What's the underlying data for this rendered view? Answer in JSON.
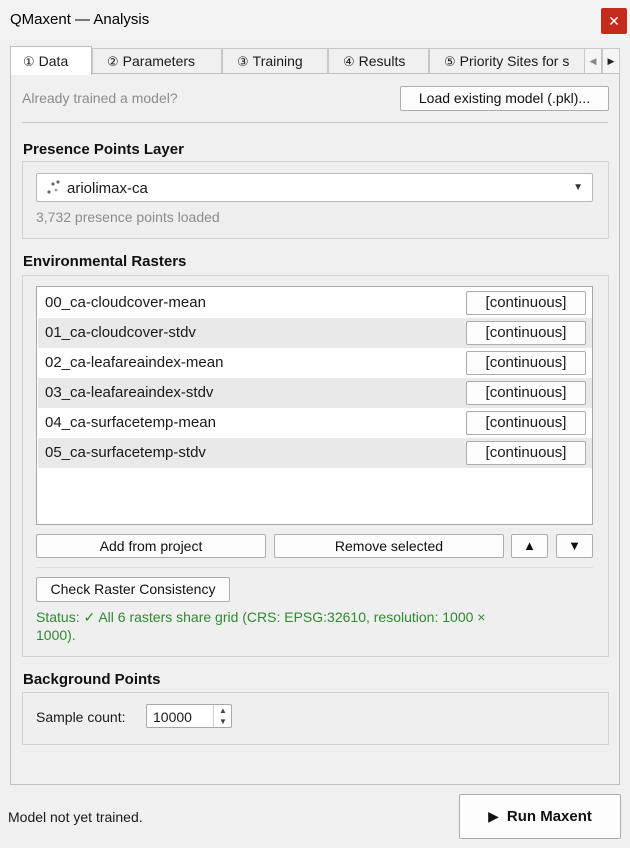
{
  "window": {
    "title": "QMaxent — Analysis",
    "close_glyph": "✕"
  },
  "tabs": [
    {
      "num": "①",
      "label": "Data"
    },
    {
      "num": "②",
      "label": "Parameters"
    },
    {
      "num": "③",
      "label": "Training"
    },
    {
      "num": "④",
      "label": "Results"
    },
    {
      "num": "⑤",
      "label": "Priority Sites for s"
    }
  ],
  "tab_scroll": {
    "left": "◀",
    "right": "▶"
  },
  "model": {
    "prompt": "Already trained a model?",
    "load_button": "Load existing model (.pkl)..."
  },
  "presence": {
    "title": "Presence Points Layer",
    "layer_icon": "points-layer-icon",
    "selected_layer": "ariolimax-ca",
    "dropdown_glyph": "▼",
    "status": "3,732 presence points loaded"
  },
  "rasters": {
    "title": "Environmental Rasters",
    "items": [
      {
        "name": "00_ca-cloudcover-mean",
        "type": "[continuous]"
      },
      {
        "name": "01_ca-cloudcover-stdv",
        "type": "[continuous]"
      },
      {
        "name": "02_ca-leafareaindex-mean",
        "type": "[continuous]"
      },
      {
        "name": "03_ca-leafareaindex-stdv",
        "type": "[continuous]"
      },
      {
        "name": "04_ca-surfacetemp-mean",
        "type": "[continuous]"
      },
      {
        "name": "05_ca-surfacetemp-stdv",
        "type": "[continuous]"
      }
    ],
    "add_button": "Add from project",
    "remove_button": "Remove selected",
    "up_glyph": "▲",
    "down_glyph": "▼",
    "check_button": "Check Raster Consistency",
    "status_line1": "Status: ✓ All 6 rasters share grid (CRS: EPSG:32610, resolution: 1000 ×",
    "status_line2": "1000)."
  },
  "background": {
    "title": "Background Points",
    "sample_label": "Sample count:",
    "sample_value": "10000",
    "spin_up": "▲",
    "spin_down": "▼"
  },
  "footer": {
    "status": "Model not yet trained.",
    "run_button": "Run Maxent",
    "run_glyph": "▶"
  },
  "colors": {
    "accent_close": "#c42b1c",
    "status_ok": "#2e8b2e"
  }
}
